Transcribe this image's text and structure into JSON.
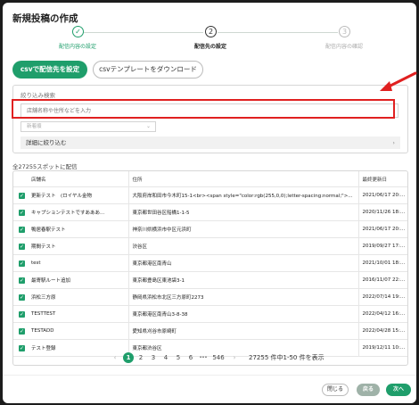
{
  "modal": {
    "title": "新規投稿の作成"
  },
  "stepper": {
    "steps": [
      {
        "number": "✓",
        "label": "配信内容の設定",
        "state": "done"
      },
      {
        "number": "2",
        "label": "配信先の設定",
        "state": "current"
      },
      {
        "number": "3",
        "label": "配信内容の確認",
        "state": "upcoming"
      }
    ]
  },
  "actions": {
    "csv_button": "csvで配信先を設定",
    "template_button": "csvテンプレートをダウンロード"
  },
  "filter": {
    "title": "絞り込み検索",
    "search_placeholder": "店舗名称や住所などを入力",
    "sort_value": "新着順",
    "detail_label": "詳細に絞り込む"
  },
  "table": {
    "count_label": "全27255スポットに配信",
    "headers": [
      "店舗名",
      "住所",
      "最終更新日"
    ],
    "rows": [
      [
        "更新テスト　(ロイヤル金物　",
        "大阪府岸和田市今木町15-1<br><span style=\"color:rgb(255,0,0);letter-spacing:normal;\">...",
        "2021/06/17 20:43"
      ],
      [
        "キャプションテストですあああ...",
        "東京都世田谷区船橋1-1-5",
        "2020/11/26 18:31"
      ],
      [
        "鴨居春駅テスト",
        "神奈川県横浜市中区元浜町",
        "2021/06/17 20:43"
      ],
      [
        "期間テスト",
        "渋谷区",
        "2019/09/27 17:15"
      ],
      [
        "test",
        "東京都港区南青山",
        "2021/10/01 18:45"
      ],
      [
        "最寄駅ルート追加",
        "東京都豊島区東池袋3-1",
        "2016/11/07 22:15"
      ],
      [
        "浜松三方原",
        "静岡県浜松市北区三方原町2273",
        "2022/07/14 19:21"
      ],
      [
        "TESTTEST",
        "東京都港区南青山3-8-38",
        "2022/04/12 16:31"
      ],
      [
        "TESTADD",
        "愛知県刈谷市原崎町",
        "2022/04/28 15:53"
      ],
      [
        "テスト登録",
        "東京都渋谷区",
        "2019/12/11 10:48"
      ]
    ]
  },
  "pagination": {
    "prev": "‹",
    "pages": [
      "1",
      "2",
      "3",
      "4",
      "5",
      "6",
      "•••",
      "546"
    ],
    "next": "›",
    "summary": "27255 件中1-50 件を表示"
  },
  "footer": {
    "close": "閉じる",
    "back": "戻る",
    "next": "次へ"
  },
  "colors": {
    "accent": "#1f9e6b",
    "annotation": "#e02020"
  }
}
